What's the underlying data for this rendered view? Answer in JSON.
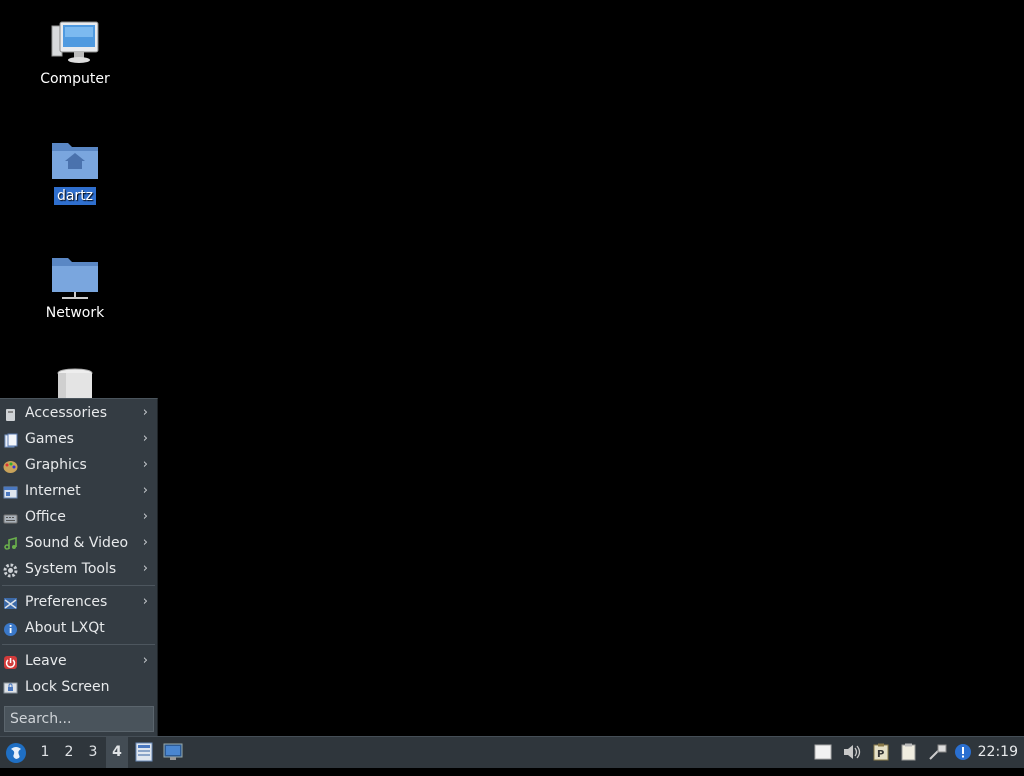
{
  "desktop": {
    "icons": [
      {
        "label": "Computer",
        "icon": "computer-icon"
      },
      {
        "label": "dartz",
        "icon": "home-folder-icon",
        "selected": true
      },
      {
        "label": "Network",
        "icon": "network-folder-icon"
      },
      {
        "label": "",
        "icon": "trash-icon"
      }
    ]
  },
  "menu": {
    "categories": [
      {
        "label": "Accessories",
        "icon": "accessories-icon",
        "submenu": true
      },
      {
        "label": "Games",
        "icon": "games-icon",
        "submenu": true
      },
      {
        "label": "Graphics",
        "icon": "graphics-icon",
        "submenu": true
      },
      {
        "label": "Internet",
        "icon": "internet-icon",
        "submenu": true
      },
      {
        "label": "Office",
        "icon": "office-icon",
        "submenu": true
      },
      {
        "label": "Sound & Video",
        "icon": "sound-video-icon",
        "submenu": true
      },
      {
        "label": "System Tools",
        "icon": "system-tools-icon",
        "submenu": true
      }
    ],
    "settings": [
      {
        "label": "Preferences",
        "icon": "preferences-icon",
        "submenu": true
      },
      {
        "label": "About LXQt",
        "icon": "about-icon",
        "submenu": false
      }
    ],
    "session": [
      {
        "label": "Leave",
        "icon": "leave-icon",
        "submenu": true
      },
      {
        "label": "Lock Screen",
        "icon": "lock-screen-icon",
        "submenu": false
      }
    ],
    "search_placeholder": "Search..."
  },
  "taskbar": {
    "desktops": [
      "1",
      "2",
      "3",
      "4"
    ],
    "active_desktop": "4",
    "clock": "22:19"
  }
}
